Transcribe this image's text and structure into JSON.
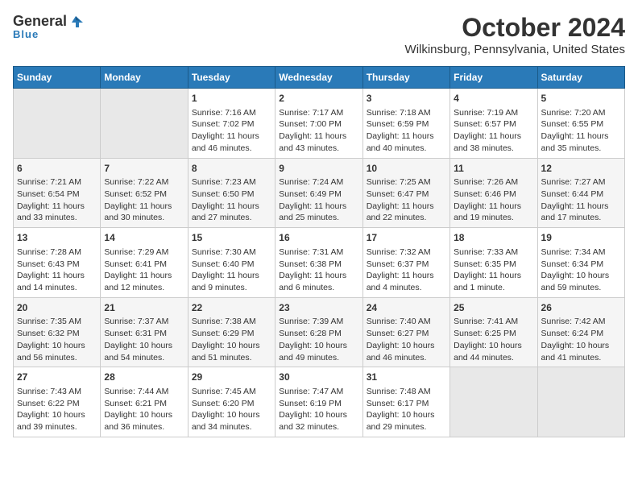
{
  "logo": {
    "line1": "General",
    "line2": "Blue"
  },
  "title": "October 2024",
  "subtitle": "Wilkinsburg, Pennsylvania, United States",
  "days_of_week": [
    "Sunday",
    "Monday",
    "Tuesday",
    "Wednesday",
    "Thursday",
    "Friday",
    "Saturday"
  ],
  "weeks": [
    [
      {
        "day": "",
        "content": ""
      },
      {
        "day": "",
        "content": ""
      },
      {
        "day": "1",
        "content": "Sunrise: 7:16 AM\nSunset: 7:02 PM\nDaylight: 11 hours and 46 minutes."
      },
      {
        "day": "2",
        "content": "Sunrise: 7:17 AM\nSunset: 7:00 PM\nDaylight: 11 hours and 43 minutes."
      },
      {
        "day": "3",
        "content": "Sunrise: 7:18 AM\nSunset: 6:59 PM\nDaylight: 11 hours and 40 minutes."
      },
      {
        "day": "4",
        "content": "Sunrise: 7:19 AM\nSunset: 6:57 PM\nDaylight: 11 hours and 38 minutes."
      },
      {
        "day": "5",
        "content": "Sunrise: 7:20 AM\nSunset: 6:55 PM\nDaylight: 11 hours and 35 minutes."
      }
    ],
    [
      {
        "day": "6",
        "content": "Sunrise: 7:21 AM\nSunset: 6:54 PM\nDaylight: 11 hours and 33 minutes."
      },
      {
        "day": "7",
        "content": "Sunrise: 7:22 AM\nSunset: 6:52 PM\nDaylight: 11 hours and 30 minutes."
      },
      {
        "day": "8",
        "content": "Sunrise: 7:23 AM\nSunset: 6:50 PM\nDaylight: 11 hours and 27 minutes."
      },
      {
        "day": "9",
        "content": "Sunrise: 7:24 AM\nSunset: 6:49 PM\nDaylight: 11 hours and 25 minutes."
      },
      {
        "day": "10",
        "content": "Sunrise: 7:25 AM\nSunset: 6:47 PM\nDaylight: 11 hours and 22 minutes."
      },
      {
        "day": "11",
        "content": "Sunrise: 7:26 AM\nSunset: 6:46 PM\nDaylight: 11 hours and 19 minutes."
      },
      {
        "day": "12",
        "content": "Sunrise: 7:27 AM\nSunset: 6:44 PM\nDaylight: 11 hours and 17 minutes."
      }
    ],
    [
      {
        "day": "13",
        "content": "Sunrise: 7:28 AM\nSunset: 6:43 PM\nDaylight: 11 hours and 14 minutes."
      },
      {
        "day": "14",
        "content": "Sunrise: 7:29 AM\nSunset: 6:41 PM\nDaylight: 11 hours and 12 minutes."
      },
      {
        "day": "15",
        "content": "Sunrise: 7:30 AM\nSunset: 6:40 PM\nDaylight: 11 hours and 9 minutes."
      },
      {
        "day": "16",
        "content": "Sunrise: 7:31 AM\nSunset: 6:38 PM\nDaylight: 11 hours and 6 minutes."
      },
      {
        "day": "17",
        "content": "Sunrise: 7:32 AM\nSunset: 6:37 PM\nDaylight: 11 hours and 4 minutes."
      },
      {
        "day": "18",
        "content": "Sunrise: 7:33 AM\nSunset: 6:35 PM\nDaylight: 11 hours and 1 minute."
      },
      {
        "day": "19",
        "content": "Sunrise: 7:34 AM\nSunset: 6:34 PM\nDaylight: 10 hours and 59 minutes."
      }
    ],
    [
      {
        "day": "20",
        "content": "Sunrise: 7:35 AM\nSunset: 6:32 PM\nDaylight: 10 hours and 56 minutes."
      },
      {
        "day": "21",
        "content": "Sunrise: 7:37 AM\nSunset: 6:31 PM\nDaylight: 10 hours and 54 minutes."
      },
      {
        "day": "22",
        "content": "Sunrise: 7:38 AM\nSunset: 6:29 PM\nDaylight: 10 hours and 51 minutes."
      },
      {
        "day": "23",
        "content": "Sunrise: 7:39 AM\nSunset: 6:28 PM\nDaylight: 10 hours and 49 minutes."
      },
      {
        "day": "24",
        "content": "Sunrise: 7:40 AM\nSunset: 6:27 PM\nDaylight: 10 hours and 46 minutes."
      },
      {
        "day": "25",
        "content": "Sunrise: 7:41 AM\nSunset: 6:25 PM\nDaylight: 10 hours and 44 minutes."
      },
      {
        "day": "26",
        "content": "Sunrise: 7:42 AM\nSunset: 6:24 PM\nDaylight: 10 hours and 41 minutes."
      }
    ],
    [
      {
        "day": "27",
        "content": "Sunrise: 7:43 AM\nSunset: 6:22 PM\nDaylight: 10 hours and 39 minutes."
      },
      {
        "day": "28",
        "content": "Sunrise: 7:44 AM\nSunset: 6:21 PM\nDaylight: 10 hours and 36 minutes."
      },
      {
        "day": "29",
        "content": "Sunrise: 7:45 AM\nSunset: 6:20 PM\nDaylight: 10 hours and 34 minutes."
      },
      {
        "day": "30",
        "content": "Sunrise: 7:47 AM\nSunset: 6:19 PM\nDaylight: 10 hours and 32 minutes."
      },
      {
        "day": "31",
        "content": "Sunrise: 7:48 AM\nSunset: 6:17 PM\nDaylight: 10 hours and 29 minutes."
      },
      {
        "day": "",
        "content": ""
      },
      {
        "day": "",
        "content": ""
      }
    ]
  ]
}
